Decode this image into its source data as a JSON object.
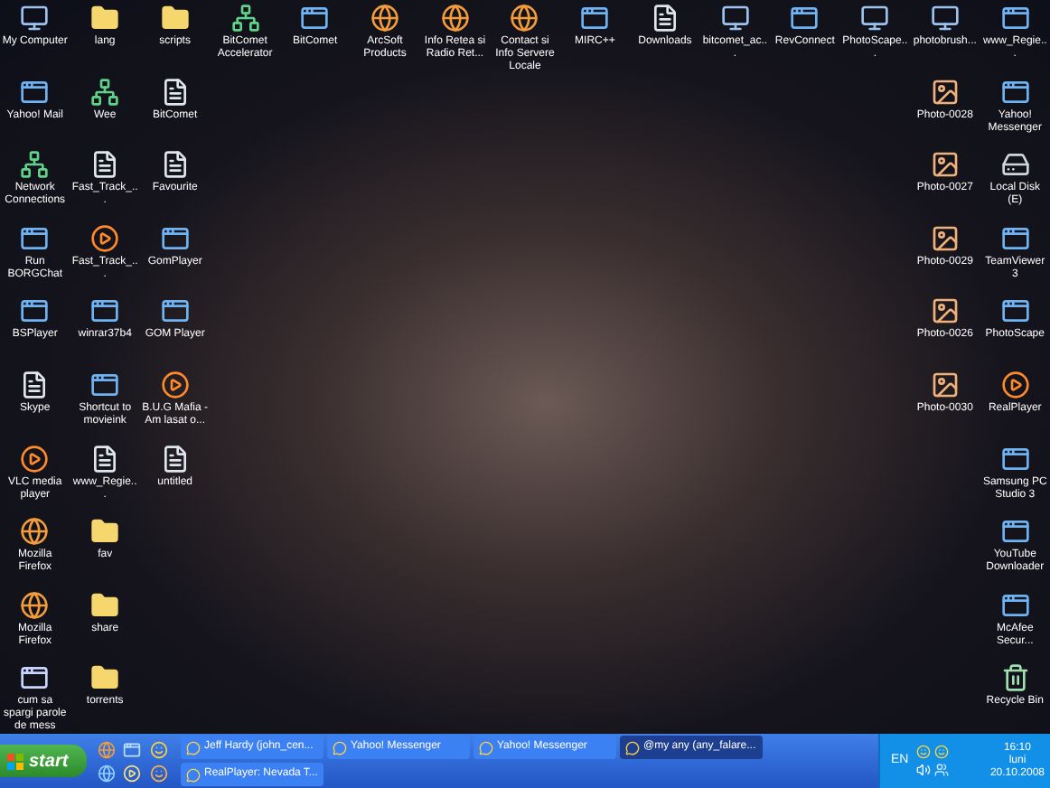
{
  "desktop": {
    "columns": [
      [
        {
          "label": "My Computer",
          "kind": "computer"
        },
        {
          "label": "Yahoo! Mail",
          "kind": "app"
        },
        {
          "label": "Network Connections",
          "kind": "network"
        },
        {
          "label": "Run BORGChat",
          "kind": "app"
        },
        {
          "label": "BSPlayer",
          "kind": "app"
        },
        {
          "label": "Skype",
          "kind": "file"
        },
        {
          "label": "VLC media player",
          "kind": "media"
        },
        {
          "label": "Mozilla Firefox",
          "kind": "browser"
        },
        {
          "label": "Mozilla Firefox",
          "kind": "browser"
        },
        {
          "label": "cum sa spargi parole de mess",
          "kind": "window"
        }
      ],
      [
        {
          "label": "lang",
          "kind": "folder"
        },
        {
          "label": "Wee",
          "kind": "network"
        },
        {
          "label": "Fast_Track_...",
          "kind": "file"
        },
        {
          "label": "Fast_Track_...",
          "kind": "media"
        },
        {
          "label": "winrar37b4",
          "kind": "app"
        },
        {
          "label": "Shortcut to movieink",
          "kind": "app"
        },
        {
          "label": "www_Regie...",
          "kind": "file"
        },
        {
          "label": "fav",
          "kind": "folder"
        },
        {
          "label": "share",
          "kind": "folder"
        },
        {
          "label": "torrents",
          "kind": "folder"
        }
      ],
      [
        {
          "label": "scripts",
          "kind": "folder"
        },
        {
          "label": "BitComet",
          "kind": "file"
        },
        {
          "label": "Favourite",
          "kind": "file"
        },
        {
          "label": "GomPlayer",
          "kind": "app"
        },
        {
          "label": "GOM Player",
          "kind": "app"
        },
        {
          "label": "B.U.G Mafia - Am lasat o...",
          "kind": "media"
        },
        {
          "label": "untitled",
          "kind": "file"
        }
      ],
      [
        {
          "label": "BitComet Accelerator",
          "kind": "network"
        }
      ],
      [
        {
          "label": "BitComet",
          "kind": "app"
        }
      ],
      [
        {
          "label": "ArcSoft Products",
          "kind": "browser"
        }
      ],
      [
        {
          "label": "Info Retea si Radio Ret...",
          "kind": "browser"
        }
      ],
      [
        {
          "label": "Contact si Info Servere Locale",
          "kind": "browser"
        }
      ],
      [
        {
          "label": "MIRC++",
          "kind": "app"
        }
      ],
      [
        {
          "label": "Downloads",
          "kind": "file"
        }
      ],
      [
        {
          "label": "bitcomet_ac...",
          "kind": "computer"
        }
      ],
      [
        {
          "label": "RevConnect",
          "kind": "app"
        }
      ],
      [
        {
          "label": "PhotoScape...",
          "kind": "computer"
        }
      ],
      [
        {
          "label": "photobrush...",
          "kind": "computer"
        },
        {
          "label": "Photo-0028",
          "kind": "photo"
        },
        {
          "label": "Photo-0027",
          "kind": "photo"
        },
        {
          "label": "Photo-0029",
          "kind": "photo"
        },
        {
          "label": "Photo-0026",
          "kind": "photo"
        },
        {
          "label": "Photo-0030",
          "kind": "photo"
        }
      ],
      [
        {
          "label": "www_Regie...",
          "kind": "app"
        },
        {
          "label": "Yahoo! Messenger",
          "kind": "app"
        },
        {
          "label": "Local Disk (E)",
          "kind": "drive"
        },
        {
          "label": "TeamViewer 3",
          "kind": "app"
        },
        {
          "label": "PhotoScape",
          "kind": "app"
        },
        {
          "label": "RealPlayer",
          "kind": "media"
        },
        {
          "label": "Samsung PC Studio 3",
          "kind": "app"
        },
        {
          "label": "YouTube Downloader",
          "kind": "app"
        },
        {
          "label": "McAfee Secur...",
          "kind": "app"
        },
        {
          "label": "Recycle Bin",
          "kind": "recycle"
        }
      ]
    ]
  },
  "taskbar": {
    "start": "start",
    "tasks": [
      {
        "label": "Jeff Hardy (john_cen...",
        "selected": false
      },
      {
        "label": "Yahoo! Messenger",
        "selected": false
      },
      {
        "label": "Yahoo! Messenger",
        "selected": false
      },
      {
        "label": "@my any (any_falare...",
        "selected": true
      },
      {
        "label": "RealPlayer: Nevada T...",
        "selected": false
      }
    ],
    "tray": {
      "language": "EN",
      "time": "16:10",
      "day": "luni",
      "date": "20.10.2008"
    }
  }
}
